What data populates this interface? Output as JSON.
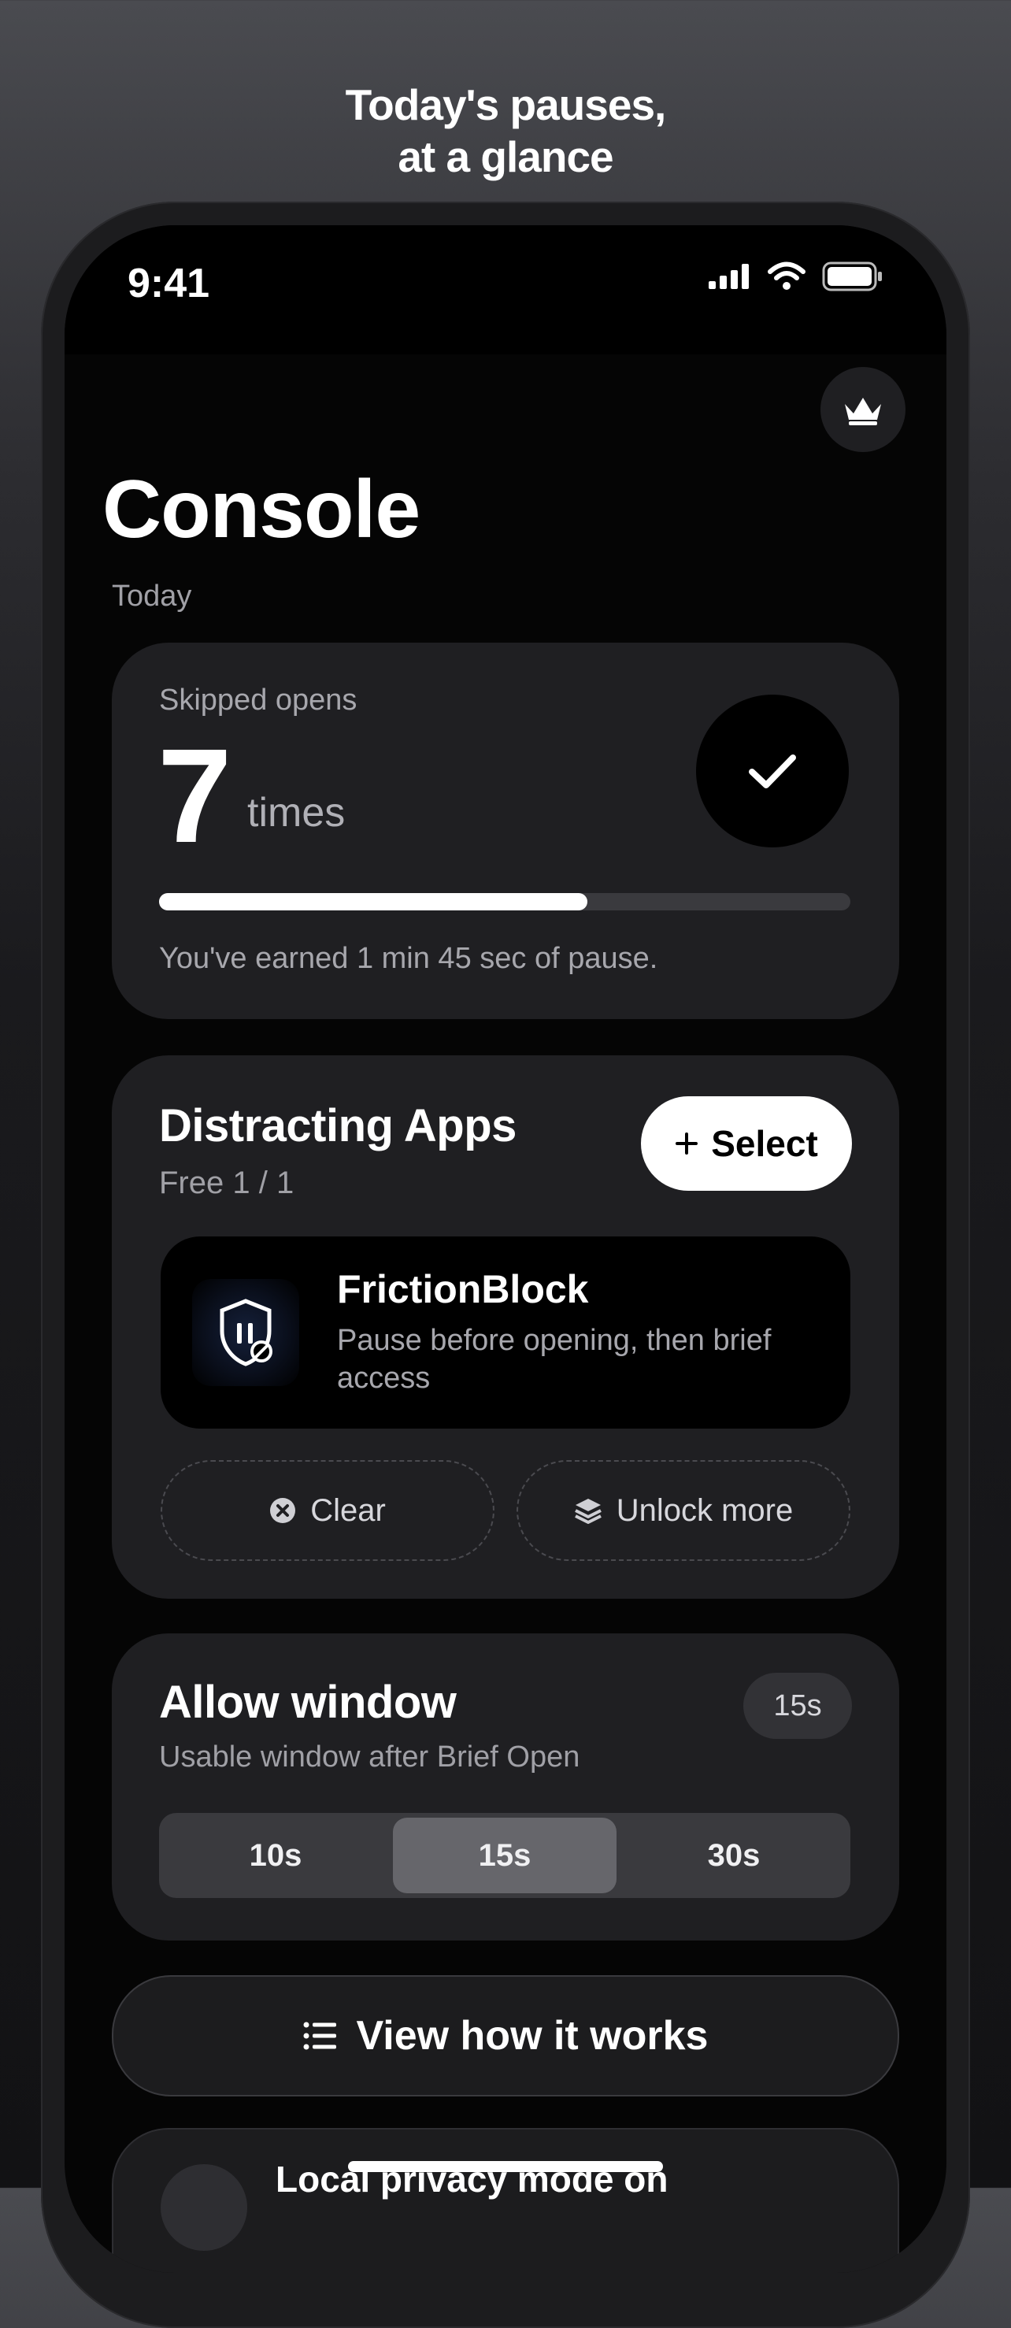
{
  "headline": {
    "line1": "Today's pauses,",
    "line2": "at a glance"
  },
  "status_bar": {
    "time": "9:41"
  },
  "header": {
    "title": "Console",
    "subtitle": "Today"
  },
  "stats": {
    "label": "Skipped opens",
    "value": "7",
    "unit": "times",
    "progress_fraction": 0.62,
    "note": "You've earned 1 min 45 sec of pause."
  },
  "apps": {
    "title": "Distracting Apps",
    "plan": "Free 1 / 1",
    "select_label": "Select",
    "app": {
      "name": "FrictionBlock",
      "description": "Pause before opening, then brief access"
    },
    "clear_label": "Clear",
    "unlock_label": "Unlock more"
  },
  "allow_window": {
    "title": "Allow window",
    "badge": "15s",
    "subtitle": "Usable window after Brief Open",
    "options": [
      "10s",
      "15s",
      "30s"
    ],
    "selected": "15s"
  },
  "how_button": {
    "label": "View how it works"
  },
  "privacy": {
    "label": "Local privacy mode on"
  },
  "colors": {
    "background": "#050505",
    "card": "#1f1f22",
    "accent": "#ffffff",
    "muted": "#a0a0a6"
  }
}
